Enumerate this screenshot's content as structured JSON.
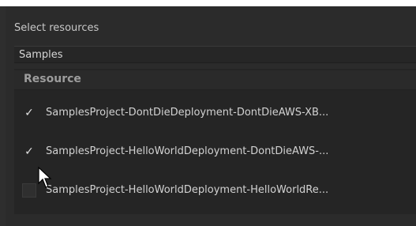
{
  "select_label": "Select resources",
  "dropdown_value": "Samples",
  "table": {
    "header": "Resource",
    "rows": [
      {
        "label": "SamplesProject-DontDieDeployment-DontDieAWS-XB...",
        "checked": true
      },
      {
        "label": "SamplesProject-HelloWorldDeployment-DontDieAWS-...",
        "checked": true
      },
      {
        "label": "SamplesProject-HelloWorldDeployment-HelloWorldRe...",
        "checked": false
      }
    ]
  },
  "colors": {
    "background": "#2e2e2e",
    "text": "#cfcfcf",
    "header_text": "#9d9d9d"
  },
  "icons": {
    "check": "checkmark-icon",
    "cursor": "mouse-pointer-icon"
  }
}
